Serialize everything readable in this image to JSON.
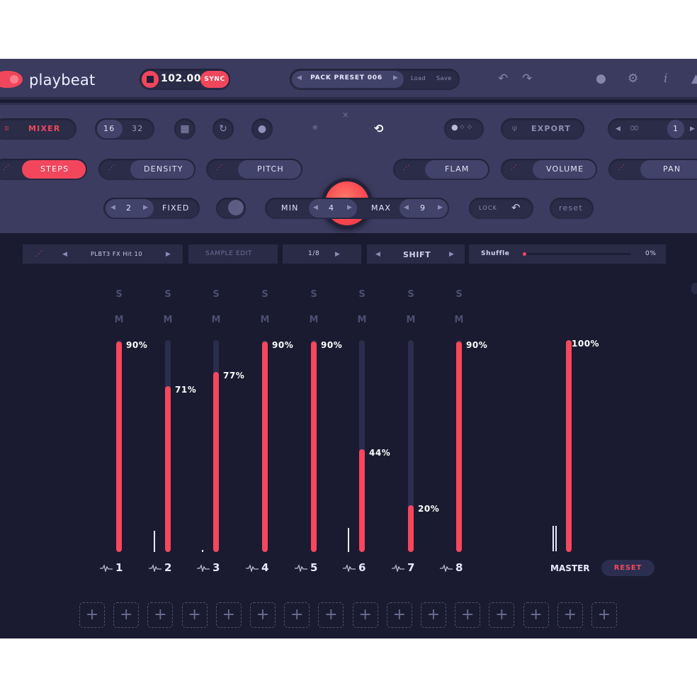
{
  "app": {
    "brand": "playbeat"
  },
  "transport": {
    "bpm": "102.00",
    "sync_label": "SYNC"
  },
  "preset": {
    "name": "PACK PRESET 006",
    "load_label": "Load",
    "save_label": "Save"
  },
  "row1": {
    "mixer_label": "MIXER",
    "steps_16": "16",
    "steps_32": "32",
    "export_label": "EXPORT",
    "page_value": "1"
  },
  "row2": {
    "steps": "STEPS",
    "density": "DENSITY",
    "pitch": "PITCH",
    "flam": "FLAM",
    "volume": "VOLUME",
    "pan": "PAN"
  },
  "row3": {
    "fixed_value": "2",
    "fixed_label": "FIXED",
    "min_label": "MIN",
    "min_value": "4",
    "max_label": "MAX",
    "max_value": "9",
    "lock_label": "LOCK",
    "reset_label": "reset"
  },
  "strip": {
    "sample_name": "PLBT3 FX Hit 10",
    "sample_edit": "SAMPLE EDIT",
    "division": "1/8",
    "shift": "SHIFT",
    "shuffle_label": "Shuffle",
    "shuffle_value": "0%"
  },
  "mixer": {
    "solo_label": "S",
    "mute_label": "M",
    "channels": [
      {
        "number": "1",
        "level": 90,
        "label": "90%"
      },
      {
        "number": "2",
        "level": 71,
        "label": "71%"
      },
      {
        "number": "3",
        "level": 77,
        "label": "77%"
      },
      {
        "number": "4",
        "level": 90,
        "label": "90%"
      },
      {
        "number": "5",
        "level": 90,
        "label": "90%"
      },
      {
        "number": "6",
        "level": 44,
        "label": "44%"
      },
      {
        "number": "7",
        "level": 20,
        "label": "20%"
      },
      {
        "number": "8",
        "level": 90,
        "label": "90%"
      }
    ],
    "master": {
      "label": "MASTER",
      "level": 100,
      "value": "100%",
      "reset_label": "RESET"
    }
  },
  "colors": {
    "accent": "#f5475d",
    "panel": "#3b3c60",
    "background": "#1a1b30"
  },
  "icons": [
    "stop-icon",
    "undo-icon",
    "redo-icon",
    "globe-icon",
    "gear-icon",
    "info-icon",
    "user-icon",
    "grid-icon",
    "refresh-icon",
    "dice-icon",
    "link-icon",
    "waveform-icon",
    "plus-icon"
  ]
}
